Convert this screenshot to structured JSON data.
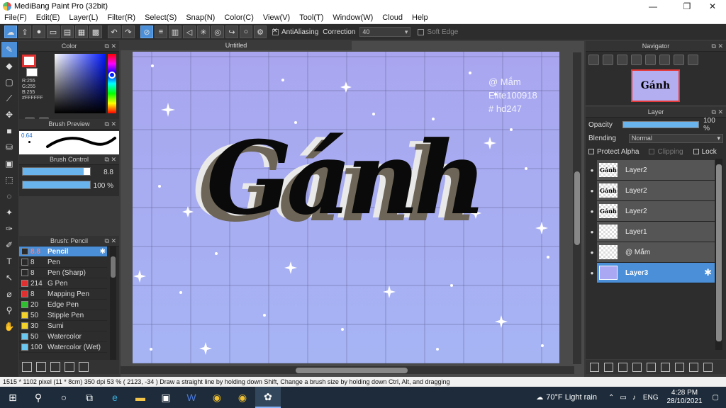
{
  "window": {
    "title": "MediBang Paint Pro (32bit)",
    "min_glyph": "—",
    "max_glyph": "❐",
    "close_glyph": "✕"
  },
  "menu": [
    "File(F)",
    "Edit(E)",
    "Layer(L)",
    "Filter(R)",
    "Select(S)",
    "Snap(N)",
    "Color(C)",
    "View(V)",
    "Tool(T)",
    "Window(W)",
    "Cloud",
    "Help"
  ],
  "toolbar": {
    "antialiasing_label": "AntiAliasing",
    "correction_label": "Correction",
    "correction_value": "40",
    "soft_edge_label": "Soft Edge"
  },
  "panels": {
    "color": {
      "title": "Color",
      "r": "R:255",
      "g": "G:255",
      "b": "B:255",
      "hex": "#FFFFFF",
      "fg": "#ffffff",
      "fg_border": "#e03030"
    },
    "brush_preview": {
      "title": "Brush Preview",
      "size": "0.64"
    },
    "brush_control": {
      "title": "Brush Control",
      "size": "8.8",
      "opacity": "100 %",
      "size_fill": 0.9,
      "opacity_fill": 1.0
    },
    "brush_list": {
      "title": "Brush: Pencil",
      "items": [
        {
          "num": "8.8",
          "name": "Pencil",
          "color": "#2a2a2a"
        },
        {
          "num": "8",
          "name": "Pen",
          "color": "#2a2a2a"
        },
        {
          "num": "8",
          "name": "Pen (Sharp)",
          "color": "#2a2a2a"
        },
        {
          "num": "214",
          "name": "G Pen",
          "color": "#e03030"
        },
        {
          "num": "8",
          "name": "Mapping Pen",
          "color": "#e03030"
        },
        {
          "num": "20",
          "name": "Edge Pen",
          "color": "#2fbf2f"
        },
        {
          "num": "50",
          "name": "Stipple Pen",
          "color": "#f2d22a"
        },
        {
          "num": "30",
          "name": "Sumi",
          "color": "#f2d22a"
        },
        {
          "num": "50",
          "name": "Watercolor",
          "color": "#6ac8f0"
        },
        {
          "num": "100",
          "name": "Watercolor (Wet)",
          "color": "#6ac8f0"
        }
      ]
    }
  },
  "canvas": {
    "tab_title": "Untitled",
    "artwork_text": "Gánh",
    "watermark": [
      "@ Mắm",
      "Elite100918",
      "# hd247"
    ],
    "bg_top": "#a9a6ef",
    "bg_bottom": "#a6b4f4"
  },
  "navigator": {
    "title": "Navigator",
    "thumb_text": "Gánh"
  },
  "layer_panel": {
    "title": "Layer",
    "opacity_label": "Opacity",
    "opacity_value": "100 %",
    "blending_label": "Blending",
    "blending_value": "Normal",
    "protect_alpha": "Protect Alpha",
    "clipping": "Clipping",
    "lock": "Lock",
    "layers": [
      {
        "name": "Layer2",
        "thumb": "Gánh",
        "selected": false
      },
      {
        "name": "Layer2",
        "thumb": "Gánh",
        "selected": false
      },
      {
        "name": "Layer2",
        "thumb": "Gánh",
        "selected": false
      },
      {
        "name": "Layer1",
        "thumb": "",
        "selected": false
      },
      {
        "name": "@ Mắm",
        "thumb": "",
        "selected": false
      },
      {
        "name": "Layer3",
        "thumb": "",
        "selected": true
      }
    ]
  },
  "statusbar": {
    "text": "1515 * 1102 pixel  (11 * 8cm)  350 dpi  53 %  ( 2123, -34 )  Draw a straight line by holding down Shift, Change a brush size by holding down Ctrl, Alt, and dragging"
  },
  "taskbar": {
    "weather": "70°F  Light rain",
    "lang": "ENG",
    "time": "4:28 PM",
    "date": "28/10/2021"
  }
}
